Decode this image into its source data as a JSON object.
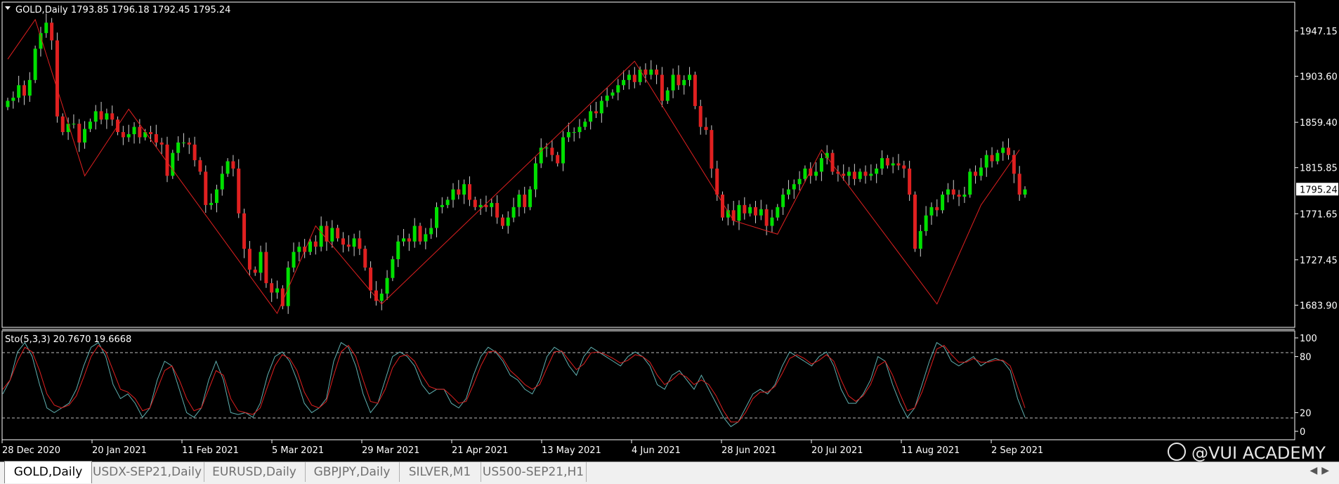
{
  "main_pane": {
    "symbol_label": "GOLD,Daily",
    "ohlc": "1793.85 1796.18 1792.45 1795.24",
    "price_ticks": [
      "1947.15",
      "1903.60",
      "1859.40",
      "1815.85",
      "1771.65",
      "1727.45",
      "1683.90"
    ],
    "current_price": "1795.24"
  },
  "indicator_pane": {
    "label": "Sto(5,3,3) 20.7670 19.6668",
    "ticks": [
      "100",
      "80",
      "20",
      "0"
    ]
  },
  "time_axis": [
    "28 Dec 2020",
    "20 Jan 2021",
    "11 Feb 2021",
    "5 Mar 2021",
    "29 Mar 2021",
    "21 Apr 2021",
    "13 May 2021",
    "4 Jun 2021",
    "28 Jun 2021",
    "20 Jul 2021",
    "11 Aug 2021",
    "2 Sep 2021"
  ],
  "tabs": [
    "GOLD,Daily",
    "USDX-SEP21,Daily",
    "EURUSD,Daily",
    "GBPJPY,Daily",
    "SILVER,M1",
    "US500-SEP21,H1"
  ],
  "watermark": "@VUI ACADEMY",
  "colors": {
    "background": "#000000",
    "up": "#00e000",
    "down": "#e02020",
    "zigzag": "#e02020",
    "stoch_main": "#5fb0b0",
    "stoch_signal": "#e02020",
    "text": "#ffffff"
  },
  "chart_data": {
    "type": "candlestick",
    "title": "GOLD,Daily",
    "ylim": [
      1668,
      1968
    ],
    "x_labels": [
      "28 Dec 2020",
      "20 Jan 2021",
      "11 Feb 2021",
      "5 Mar 2021",
      "29 Mar 2021",
      "21 Apr 2021",
      "13 May 2021",
      "4 Jun 2021",
      "28 Jun 2021",
      "20 Jul 2021",
      "11 Aug 2021",
      "2 Sep 2021"
    ],
    "last_close": 1795.24,
    "closes": [
      1880,
      1883,
      1895,
      1885,
      1900,
      1930,
      1945,
      1955,
      1938,
      1865,
      1850,
      1858,
      1858,
      1840,
      1853,
      1860,
      1870,
      1862,
      1868,
      1862,
      1850,
      1845,
      1848,
      1855,
      1845,
      1850,
      1848,
      1840,
      1838,
      1808,
      1830,
      1840,
      1840,
      1838,
      1823,
      1812,
      1780,
      1782,
      1795,
      1810,
      1822,
      1815,
      1772,
      1738,
      1718,
      1715,
      1735,
      1705,
      1696,
      1700,
      1683,
      1720,
      1735,
      1740,
      1735,
      1745,
      1740,
      1760,
      1745,
      1758,
      1748,
      1742,
      1740,
      1748,
      1738,
      1720,
      1698,
      1688,
      1695,
      1710,
      1728,
      1745,
      1748,
      1745,
      1760,
      1745,
      1752,
      1758,
      1778,
      1780,
      1785,
      1795,
      1790,
      1800,
      1785,
      1778,
      1780,
      1778,
      1782,
      1768,
      1760,
      1768,
      1778,
      1790,
      1778,
      1795,
      1820,
      1835,
      1835,
      1828,
      1820,
      1845,
      1850,
      1850,
      1855,
      1860,
      1870,
      1868,
      1880,
      1885,
      1888,
      1895,
      1900,
      1905,
      1898,
      1910,
      1905,
      1910,
      1905,
      1880,
      1890,
      1905,
      1895,
      1900,
      1905,
      1875,
      1855,
      1852,
      1815,
      1790,
      1768,
      1775,
      1765,
      1780,
      1772,
      1778,
      1770,
      1776,
      1760,
      1768,
      1778,
      1790,
      1795,
      1800,
      1805,
      1815,
      1808,
      1812,
      1825,
      1830,
      1812,
      1810,
      1808,
      1812,
      1805,
      1812,
      1808,
      1810,
      1815,
      1825,
      1818,
      1820,
      1818,
      1815,
      1790,
      1738,
      1755,
      1770,
      1778,
      1775,
      1790,
      1795,
      1790,
      1788,
      1790,
      1812,
      1808,
      1816,
      1828,
      1822,
      1830,
      1835,
      1828,
      1810,
      1790,
      1795
    ],
    "zigzag": [
      [
        0,
        1920
      ],
      [
        5,
        1958
      ],
      [
        14,
        1808
      ],
      [
        22,
        1872
      ],
      [
        49,
        1676
      ],
      [
        56,
        1760
      ],
      [
        68,
        1685
      ],
      [
        114,
        1918
      ],
      [
        132,
        1765
      ],
      [
        140,
        1752
      ],
      [
        148,
        1833
      ],
      [
        169,
        1685
      ],
      [
        177,
        1780
      ],
      [
        184,
        1833
      ]
    ],
    "stochastic": {
      "name": "Sto(5,3,3)",
      "main": [
        40,
        55,
        85,
        95,
        80,
        50,
        25,
        20,
        25,
        30,
        45,
        70,
        90,
        95,
        80,
        50,
        35,
        40,
        30,
        15,
        25,
        55,
        75,
        70,
        45,
        20,
        15,
        25,
        55,
        75,
        55,
        20,
        18,
        20,
        15,
        30,
        60,
        80,
        85,
        75,
        55,
        30,
        20,
        25,
        35,
        75,
        95,
        90,
        70,
        40,
        20,
        30,
        55,
        80,
        85,
        80,
        70,
        50,
        40,
        45,
        45,
        30,
        25,
        35,
        60,
        80,
        90,
        85,
        75,
        60,
        55,
        45,
        40,
        55,
        80,
        90,
        85,
        70,
        60,
        80,
        90,
        85,
        80,
        75,
        70,
        80,
        85,
        80,
        70,
        50,
        45,
        60,
        65,
        55,
        45,
        60,
        45,
        30,
        15,
        5,
        10,
        25,
        40,
        45,
        40,
        50,
        70,
        85,
        80,
        75,
        70,
        80,
        85,
        70,
        45,
        30,
        30,
        40,
        55,
        80,
        75,
        50,
        30,
        15,
        25,
        50,
        75,
        95,
        90,
        75,
        70,
        75,
        80,
        70,
        75,
        78,
        75,
        65,
        35,
        15
      ],
      "signal": [
        45,
        55,
        75,
        90,
        85,
        65,
        40,
        28,
        25,
        28,
        38,
        58,
        80,
        92,
        85,
        65,
        45,
        42,
        35,
        22,
        25,
        45,
        65,
        70,
        55,
        35,
        22,
        25,
        45,
        65,
        60,
        35,
        22,
        20,
        18,
        25,
        48,
        70,
        82,
        78,
        65,
        42,
        28,
        25,
        32,
        60,
        85,
        92,
        80,
        55,
        32,
        30,
        45,
        68,
        80,
        82,
        75,
        60,
        48,
        45,
        45,
        38,
        30,
        32,
        50,
        70,
        85,
        86,
        78,
        65,
        58,
        50,
        45,
        50,
        68,
        85,
        86,
        76,
        66,
        72,
        84,
        85,
        82,
        78,
        73,
        76,
        82,
        80,
        74,
        60,
        50,
        55,
        62,
        58,
        50,
        55,
        50,
        38,
        22,
        10,
        10,
        20,
        35,
        42,
        42,
        48,
        62,
        78,
        82,
        78,
        72,
        76,
        82,
        75,
        55,
        38,
        32,
        38,
        50,
        70,
        75,
        60,
        40,
        22,
        25,
        42,
        65,
        88,
        92,
        82,
        74,
        74,
        78,
        74,
        74,
        76,
        76,
        70,
        48,
        25
      ]
    }
  }
}
